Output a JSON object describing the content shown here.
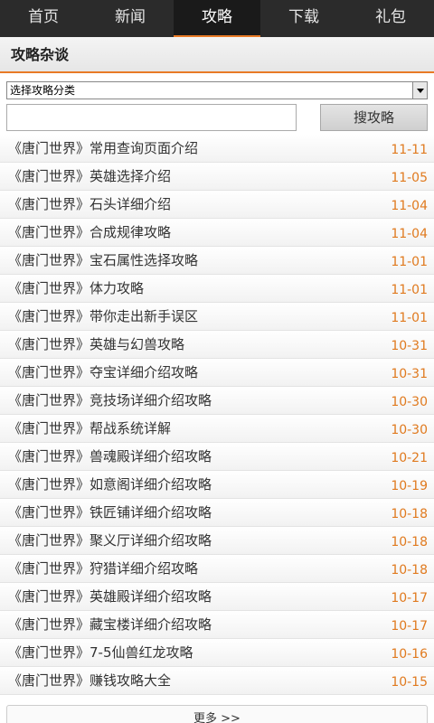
{
  "nav": {
    "items": [
      {
        "label": "首页"
      },
      {
        "label": "新闻"
      },
      {
        "label": "攻略"
      },
      {
        "label": "下载"
      },
      {
        "label": "礼包"
      }
    ],
    "active_index": 2,
    "accent_color": "#e87a26"
  },
  "section": {
    "title": "攻略杂谈"
  },
  "filter": {
    "category_selected": "选择攻略分类",
    "search_value": "",
    "search_button_label": "搜攻略"
  },
  "articles": [
    {
      "title": "《唐门世界》常用查询页面介绍",
      "date": "11-11"
    },
    {
      "title": "《唐门世界》英雄选择介绍",
      "date": "11-05"
    },
    {
      "title": "《唐门世界》石头详细介绍",
      "date": "11-04"
    },
    {
      "title": "《唐门世界》合成规律攻略",
      "date": "11-04"
    },
    {
      "title": "《唐门世界》宝石属性选择攻略",
      "date": "11-01"
    },
    {
      "title": "《唐门世界》体力攻略",
      "date": "11-01"
    },
    {
      "title": "《唐门世界》带你走出新手误区",
      "date": "11-01"
    },
    {
      "title": "《唐门世界》英雄与幻兽攻略",
      "date": "10-31"
    },
    {
      "title": "《唐门世界》夺宝详细介绍攻略",
      "date": "10-31"
    },
    {
      "title": "《唐门世界》竞技场详细介绍攻略",
      "date": "10-30"
    },
    {
      "title": "《唐门世界》帮战系统详解",
      "date": "10-30"
    },
    {
      "title": "《唐门世界》兽魂殿详细介绍攻略",
      "date": "10-21"
    },
    {
      "title": "《唐门世界》如意阁详细介绍攻略",
      "date": "10-19"
    },
    {
      "title": "《唐门世界》铁匠铺详细介绍攻略",
      "date": "10-18"
    },
    {
      "title": "《唐门世界》聚义厅详细介绍攻略",
      "date": "10-18"
    },
    {
      "title": "《唐门世界》狩猎详细介绍攻略",
      "date": "10-18"
    },
    {
      "title": "《唐门世界》英雄殿详细介绍攻略",
      "date": "10-17"
    },
    {
      "title": "《唐门世界》藏宝楼详细介绍攻略",
      "date": "10-17"
    },
    {
      "title": "《唐门世界》7-5仙兽红龙攻略",
      "date": "10-16"
    },
    {
      "title": "《唐门世界》赚钱攻略大全",
      "date": "10-15"
    }
  ],
  "more": {
    "label": "更多 >>"
  }
}
